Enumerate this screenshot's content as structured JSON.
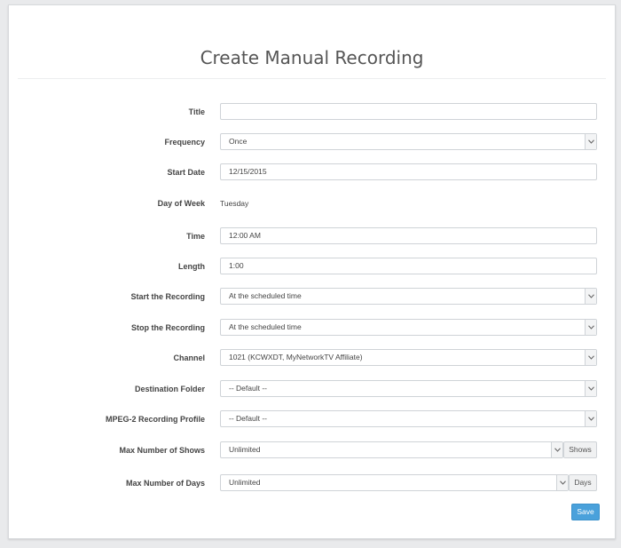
{
  "page": {
    "title": "Create Manual Recording"
  },
  "form": {
    "title": {
      "label": "Title",
      "value": ""
    },
    "frequency": {
      "label": "Frequency",
      "value": "Once"
    },
    "start_date": {
      "label": "Start Date",
      "value": "12/15/2015"
    },
    "day_of_week": {
      "label": "Day of Week",
      "value": "Tuesday"
    },
    "time": {
      "label": "Time",
      "value": "12:00 AM"
    },
    "length": {
      "label": "Length",
      "value": "1:00"
    },
    "start_recording": {
      "label": "Start the Recording",
      "value": "At the scheduled time"
    },
    "stop_recording": {
      "label": "Stop the Recording",
      "value": "At the scheduled time"
    },
    "channel": {
      "label": "Channel",
      "value": "1021 (KCWXDT, MyNetworkTV Affiliate)"
    },
    "destination_folder": {
      "label": "Destination Folder",
      "value": "-- Default --"
    },
    "mpeg2_profile": {
      "label": "MPEG-2 Recording Profile",
      "value": "-- Default --"
    },
    "max_shows": {
      "label": "Max Number of Shows",
      "value": "Unlimited",
      "addon": "Shows"
    },
    "max_days": {
      "label": "Max Number of Days",
      "value": "Unlimited",
      "addon": "Days"
    }
  },
  "actions": {
    "save_label": "Save"
  },
  "colors": {
    "accent": "#4aa1db",
    "background": "#e9eaec",
    "card": "#ffffff"
  },
  "icons": {
    "select_caret": "chevron-down-icon"
  }
}
